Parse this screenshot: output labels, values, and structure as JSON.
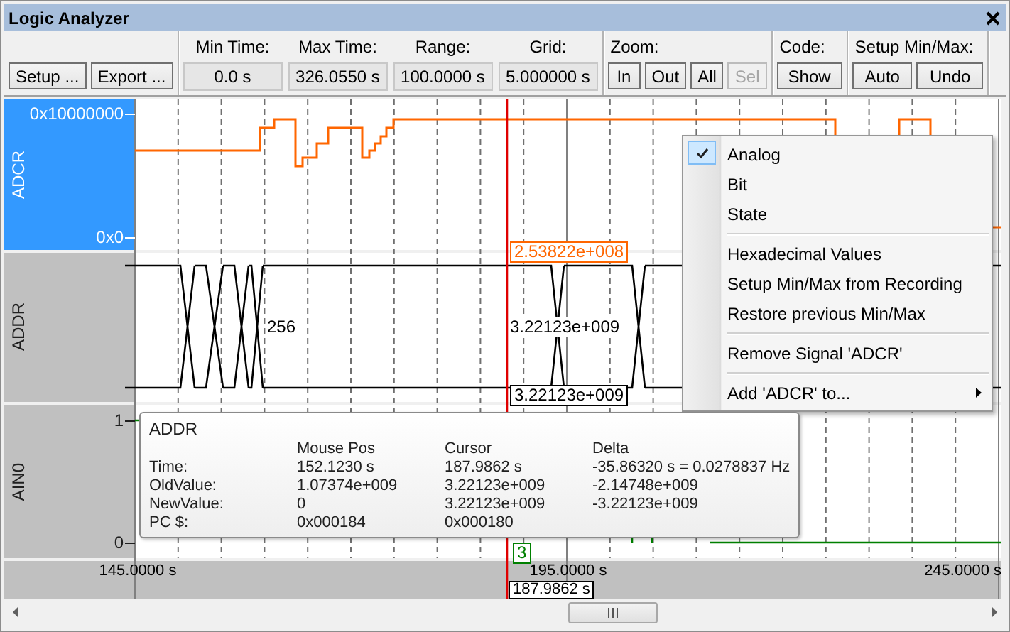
{
  "window": {
    "title": "Logic Analyzer"
  },
  "toolbar": [
    {
      "kind": "buttons",
      "buttons": [
        {
          "label": "Setup ...",
          "disabled": false
        },
        {
          "label": "Export ...",
          "disabled": false
        }
      ]
    },
    {
      "kind": "fields",
      "fields": [
        {
          "label": "Min Time:",
          "value": "0.0 s"
        },
        {
          "label": "Max Time:",
          "value": "326.0550 s"
        },
        {
          "label": "Range:",
          "value": "100.0000 s"
        },
        {
          "label": "Grid:",
          "value": "5.000000 s"
        }
      ]
    },
    {
      "kind": "buttons",
      "label": "Zoom:",
      "buttons": [
        {
          "label": "In",
          "disabled": false
        },
        {
          "label": "Out",
          "disabled": false
        },
        {
          "label": "All",
          "disabled": false
        },
        {
          "label": "Sel",
          "disabled": true
        }
      ]
    },
    {
      "kind": "buttons",
      "label": "Code:",
      "buttons": [
        {
          "label": "Show",
          "disabled": false
        }
      ]
    },
    {
      "kind": "buttons",
      "label": "Setup Min/Max:",
      "buttons": [
        {
          "label": "Auto",
          "disabled": false
        },
        {
          "label": "Undo",
          "disabled": false
        }
      ]
    }
  ],
  "signals": [
    {
      "name": "ADCR",
      "kind": "analog",
      "selected": true,
      "color": "#ff6600",
      "max_label": "0x10000000",
      "min_label": "0x0",
      "cursor_value": "2.53822e+008"
    },
    {
      "name": "ADDR",
      "kind": "bus",
      "selected": false,
      "color": "#000000",
      "value_labels": [
        "256",
        "3.22123e+009"
      ],
      "cursor_value": "3.22123e+009"
    },
    {
      "name": "AIN0",
      "kind": "bit",
      "selected": false,
      "color": "#008000",
      "max_label": "1",
      "min_label": "0",
      "cursor_value": "3"
    }
  ],
  "time_axis": {
    "ticks": [
      "145.0000 s",
      "195.0000 s",
      "245.0000 s"
    ],
    "cursor": "187.9862 s"
  },
  "context_menu": {
    "items": [
      {
        "kind": "item",
        "label": "Analog",
        "checked": true
      },
      {
        "kind": "item",
        "label": "Bit",
        "checked": false
      },
      {
        "kind": "item",
        "label": "State",
        "checked": false
      },
      {
        "kind": "separator"
      },
      {
        "kind": "item",
        "label": "Hexadecimal Values",
        "checked": false
      },
      {
        "kind": "item",
        "label": "Setup Min/Max from Recording",
        "checked": false
      },
      {
        "kind": "item",
        "label": "Restore previous Min/Max",
        "checked": false
      },
      {
        "kind": "separator"
      },
      {
        "kind": "item",
        "label": "Remove Signal 'ADCR'",
        "checked": false
      },
      {
        "kind": "separator"
      },
      {
        "kind": "submenu",
        "label": "Add 'ADCR' to...",
        "checked": false
      }
    ]
  },
  "tooltip": {
    "title": "ADDR",
    "columns": [
      "Mouse Pos",
      "Cursor",
      "Delta"
    ],
    "rows": [
      {
        "label": "Time:",
        "values": [
          "152.1230 s",
          "187.9862 s",
          "-35.86320 s = 0.0278837 Hz"
        ]
      },
      {
        "label": "OldValue:",
        "values": [
          "1.07374e+009",
          "3.22123e+009",
          "-2.14748e+009"
        ]
      },
      {
        "label": "NewValue:",
        "values": [
          "0",
          "3.22123e+009",
          "-3.22123e+009"
        ]
      },
      {
        "label": "PC $:",
        "values": [
          "0x000184",
          "0x000180"
        ]
      }
    ]
  }
}
